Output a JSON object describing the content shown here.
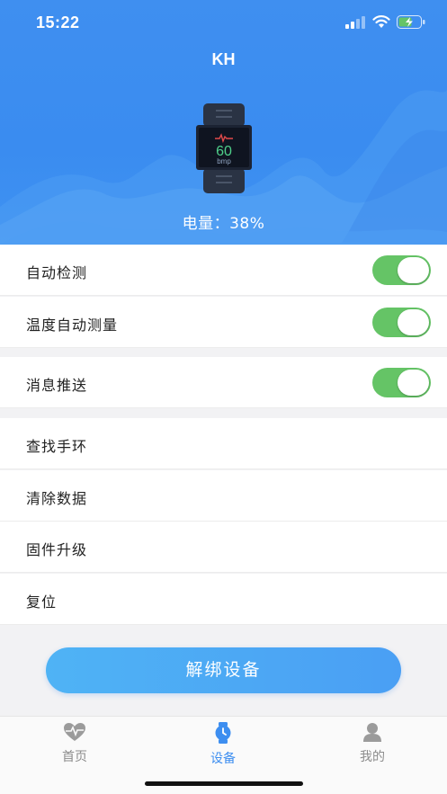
{
  "status_bar": {
    "time": "15:22",
    "icons": [
      "cellular-signal-icon",
      "wifi-icon",
      "battery-charging-icon"
    ]
  },
  "header": {
    "title": "KH",
    "watch_display": {
      "heart_rate": "60",
      "unit": "bmp"
    },
    "battery_text": "电量：38%"
  },
  "settings": {
    "auto_detect": {
      "label": "自动检测",
      "enabled": true
    },
    "temperature_auto_measure": {
      "label": "温度自动测量",
      "enabled": true
    },
    "message_push": {
      "label": "消息推送",
      "enabled": true
    },
    "find_band": {
      "label": "查找手环"
    },
    "clear_data": {
      "label": "清除数据"
    },
    "firmware_upgrade": {
      "label": "固件升级"
    },
    "reset": {
      "label": "复位"
    }
  },
  "unbind_button": {
    "label": "解绑设备"
  },
  "tabbar": {
    "tabs": [
      {
        "label": "首页",
        "icon": "heart-pulse-icon",
        "active": false
      },
      {
        "label": "设备",
        "icon": "watch-icon",
        "active": true
      },
      {
        "label": "我的",
        "icon": "user-icon",
        "active": false
      }
    ]
  },
  "colors": {
    "header_blue": "#3a8cf0",
    "toggle_green": "#65c466",
    "active_tab": "#3d8ef0",
    "button_gradient_start": "#4fb3f5",
    "button_gradient_end": "#4a9ff4"
  }
}
